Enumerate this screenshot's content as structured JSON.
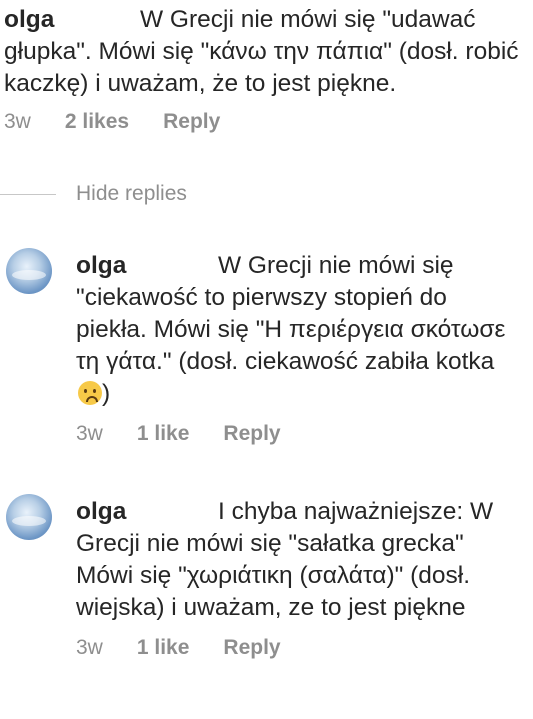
{
  "comments": [
    {
      "username": "olga",
      "text": "W Grecji nie mówi się \"udawać głupka\". Mówi się \"κάνω την πάπια\" (dosł. robić kaczkę) i uważam, że to jest piękne.",
      "time": "3w",
      "likes": "2 likes",
      "reply": "Reply"
    },
    {
      "username": "olga",
      "text": "W Grecji nie mówi się \"ciekawość to pierwszy stopień do piekła. Mówi się \"Η περιέργεια σκότωσε τη γάτα.\" (dosł. ciekawość zabiła kotka",
      "text_end": ")",
      "time": "3w",
      "likes": "1 like",
      "reply": "Reply"
    },
    {
      "username": "olga",
      "text": "I chyba najważniejsze: W Grecji nie mówi się \"sałatka grecka\" Mówi się \"χωριάτικη (σαλάτα)\" (dosł. wiejska) i uważam, ze to jest piękne",
      "time": "3w",
      "likes": "1 like",
      "reply": "Reply"
    }
  ],
  "hide_replies": "Hide replies"
}
